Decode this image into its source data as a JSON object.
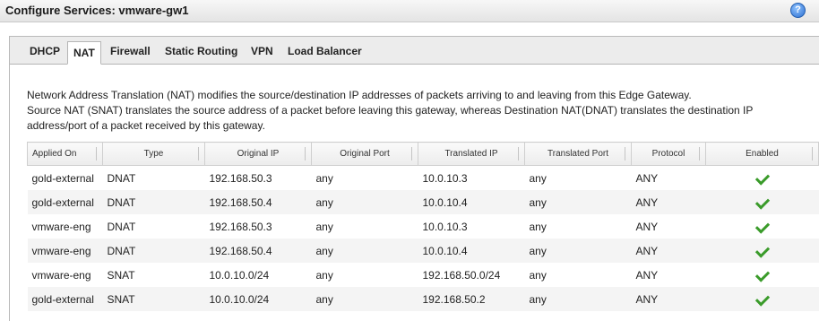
{
  "window": {
    "title": "Configure Services: vmware-gw1",
    "help_label": "?"
  },
  "tabs": [
    {
      "label": "DHCP",
      "active": false
    },
    {
      "label": "NAT",
      "active": true
    },
    {
      "label": "Firewall",
      "active": false
    },
    {
      "label": "Static Routing",
      "active": false
    },
    {
      "label": "VPN",
      "active": false
    },
    {
      "label": "Load Balancer",
      "active": false
    }
  ],
  "description": {
    "line1": "Network Address Translation (NAT) modifies the source/destination IP addresses of packets arriving to and leaving from this Edge Gateway.",
    "line2": "Source NAT (SNAT) translates the source address of a packet before leaving this gateway, whereas Destination NAT(DNAT)  translates the destination IP address/port of a packet received by this gateway."
  },
  "table": {
    "columns": [
      "Applied On",
      "Type",
      "Original IP",
      "Original Port",
      "Translated IP",
      "Translated Port",
      "Protocol",
      "Enabled"
    ],
    "rows": [
      {
        "applied_on": "gold-external",
        "type": "DNAT",
        "original_ip": "192.168.50.3",
        "original_port": "any",
        "translated_ip": "10.0.10.3",
        "translated_port": "any",
        "protocol": "ANY",
        "enabled": true
      },
      {
        "applied_on": "gold-external",
        "type": "DNAT",
        "original_ip": "192.168.50.4",
        "original_port": "any",
        "translated_ip": "10.0.10.4",
        "translated_port": "any",
        "protocol": "ANY",
        "enabled": true
      },
      {
        "applied_on": "vmware-eng",
        "type": "DNAT",
        "original_ip": "192.168.50.3",
        "original_port": "any",
        "translated_ip": "10.0.10.3",
        "translated_port": "any",
        "protocol": "ANY",
        "enabled": true
      },
      {
        "applied_on": "vmware-eng",
        "type": "DNAT",
        "original_ip": "192.168.50.4",
        "original_port": "any",
        "translated_ip": "10.0.10.4",
        "translated_port": "any",
        "protocol": "ANY",
        "enabled": true
      },
      {
        "applied_on": "vmware-eng",
        "type": "SNAT",
        "original_ip": "10.0.10.0/24",
        "original_port": "any",
        "translated_ip": "192.168.50.0/24",
        "translated_port": "any",
        "protocol": "ANY",
        "enabled": true
      },
      {
        "applied_on": "gold-external",
        "type": "SNAT",
        "original_ip": "10.0.10.0/24",
        "original_port": "any",
        "translated_ip": "192.168.50.2",
        "translated_port": "any",
        "protocol": "ANY",
        "enabled": true
      }
    ]
  },
  "colors": {
    "enabled_check": "#3a9b2a",
    "help_icon": "#2d6fd0"
  }
}
